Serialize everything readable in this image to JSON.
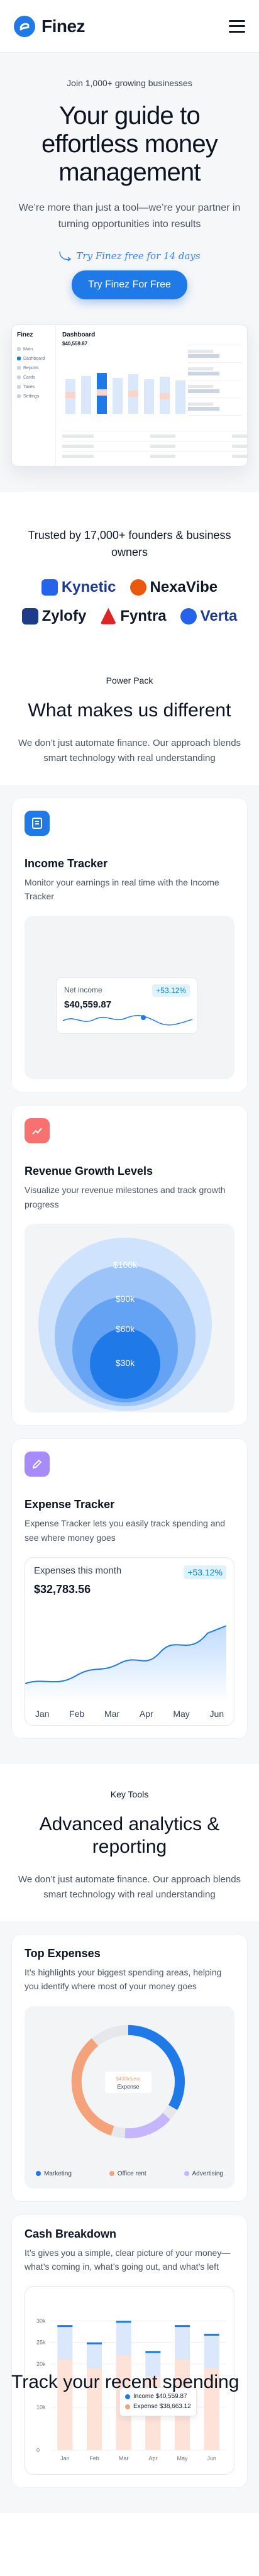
{
  "header": {
    "brand": "Finez"
  },
  "hero": {
    "kicker": "Join 1,000+ growing businesses",
    "title": "Your guide to effortless money management",
    "subtitle": "We’re more than just a tool—we’re your partner in turning opportunities into results",
    "try_note": "Try Finez free for 14 days",
    "cta": "Try Finez For Free"
  },
  "dashboard": {
    "brand": "Finez",
    "title": "Dashboard",
    "balance": "$40,559.87",
    "nav": [
      "Main",
      "Dashboard",
      "Reports",
      "Cards",
      "Taxes",
      "Settings"
    ]
  },
  "trusted": {
    "title": "Trusted by 17,000+ founders & business owners",
    "brands": [
      {
        "name": "Kynetic",
        "color": "#2563eb"
      },
      {
        "name": "NexaVibe",
        "color": "#ea580c"
      },
      {
        "name": "Zylofy",
        "color": "#1e3a8a"
      },
      {
        "name": "Fyntra",
        "color": "#dc2626"
      },
      {
        "name": "Verta",
        "color": "#2563eb"
      }
    ]
  },
  "power": {
    "kicker": "Power Pack",
    "title": "What makes us different",
    "subtitle": "We don’t just automate finance. Our approach blends smart technology with real understanding"
  },
  "cards": {
    "income": {
      "title": "Income Tracker",
      "desc": "Monitor your earnings in real time with the Income Tracker",
      "label": "Net income",
      "value": "$40,559.87",
      "badge": "+53.12%",
      "icon_color": "#1f7ae8"
    },
    "revenue": {
      "title": "Revenue Growth Levels",
      "desc": "Visualize your revenue milestones and track growth progress",
      "levels": [
        "$100k",
        "$90k",
        "$60k",
        "$30k"
      ],
      "icon_color": "#f87171"
    },
    "expense": {
      "title": "Expense Tracker",
      "desc": "Expense Tracker lets you easily track spending and see where money goes",
      "label": "Expenses this month",
      "value": "$32,783.56",
      "badge": "+53.12%",
      "months": [
        "Jan",
        "Feb",
        "Mar",
        "Apr",
        "May",
        "Jun"
      ],
      "icon_color": "#a78bfa"
    }
  },
  "tools": {
    "kicker": "Key Tools",
    "title": "Advanced analytics & reporting",
    "subtitle": "We don’t just automate finance. Our approach blends smart technology with real understanding"
  },
  "top_expenses": {
    "title": "Top Expenses",
    "desc": "It’s highlights your biggest spending areas, helping you identify where most of your money goes",
    "center_small": "$400k/year",
    "center_label": "Expense",
    "legend": [
      {
        "label": "Marketing",
        "color": "#1f7ae8"
      },
      {
        "label": "Office rent",
        "color": "#f4a27a"
      },
      {
        "label": "Advertising",
        "color": "#c4b5fd"
      }
    ]
  },
  "cash": {
    "title": "Cash Breakdown",
    "desc": "It’s gives you a simple, clear picture of your money—what’s coming in, what’s going out, and what’s left",
    "tooltip_income": "Income $40,559.87",
    "tooltip_expense": "Expense $38,663.12"
  },
  "bottom": {
    "title": "Track your recent spending"
  },
  "chart_data": [
    {
      "type": "bar",
      "title": "Cash Breakdown",
      "categories": [
        "Jan",
        "Feb",
        "Mar",
        "Apr",
        "May",
        "Jun"
      ],
      "yticks": [
        "0",
        "10k",
        "20k",
        "25k",
        "30k"
      ],
      "series": [
        {
          "name": "Income",
          "values": [
            29,
            25,
            30,
            23,
            29,
            27
          ]
        },
        {
          "name": "Expense",
          "values": [
            21,
            19,
            22,
            17,
            21,
            19
          ]
        }
      ]
    }
  ]
}
